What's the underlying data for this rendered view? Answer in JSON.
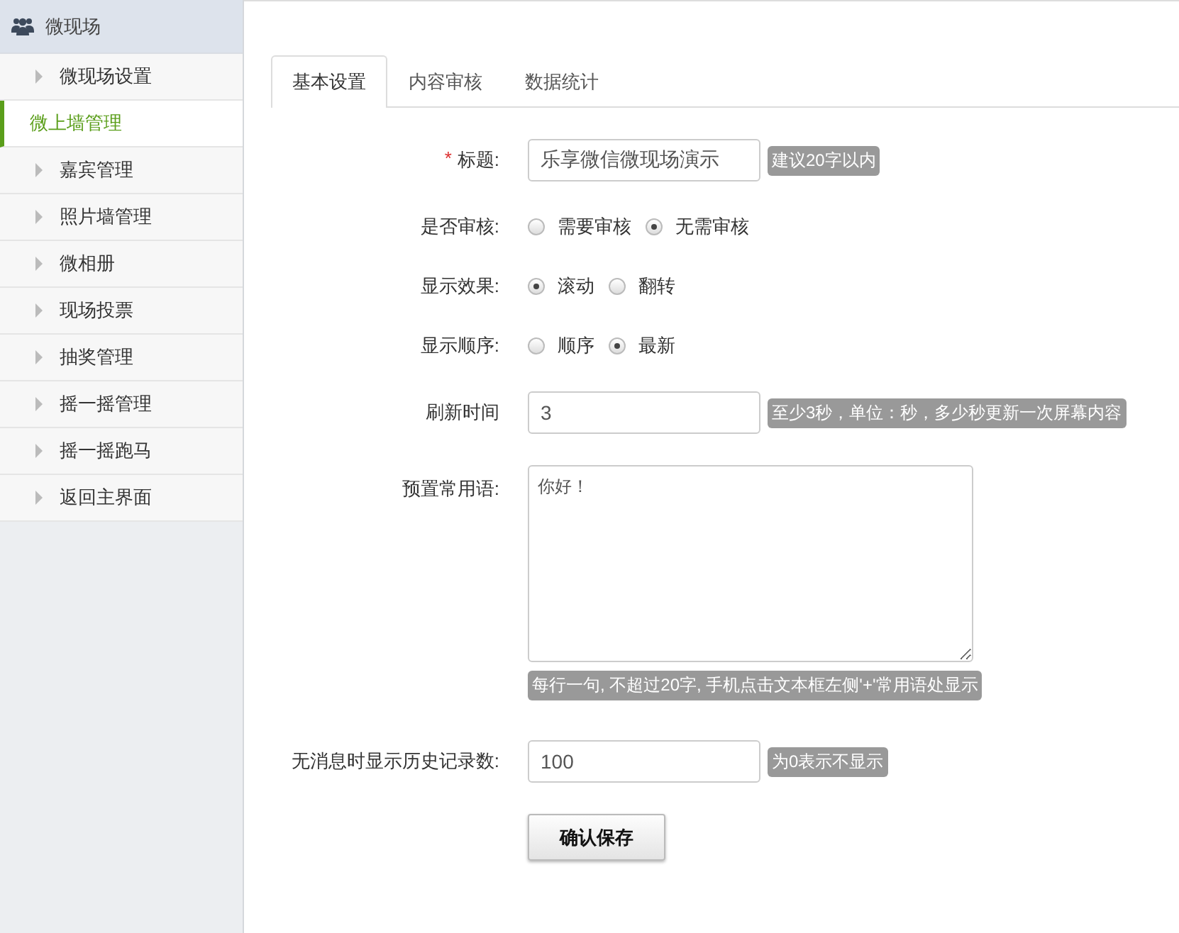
{
  "sidebar": {
    "title": "微现场",
    "items": [
      {
        "label": "微现场设置",
        "selected": false
      },
      {
        "label": "微上墙管理",
        "selected": true
      },
      {
        "label": "嘉宾管理",
        "selected": false
      },
      {
        "label": "照片墙管理",
        "selected": false
      },
      {
        "label": "微相册",
        "selected": false
      },
      {
        "label": "现场投票",
        "selected": false
      },
      {
        "label": "抽奖管理",
        "selected": false
      },
      {
        "label": "摇一摇管理",
        "selected": false
      },
      {
        "label": "摇一摇跑马",
        "selected": false
      },
      {
        "label": "返回主界面",
        "selected": false
      }
    ]
  },
  "tabs": [
    {
      "label": "基本设置",
      "selected": true
    },
    {
      "label": "内容审核",
      "selected": false
    },
    {
      "label": "数据统计",
      "selected": false
    }
  ],
  "form": {
    "fields": [
      {
        "kind": "text",
        "required_mark": "*",
        "label": "标题:",
        "value": "乐享微信微现场演示",
        "hint": "建议20字以内"
      },
      {
        "kind": "radio",
        "label": "是否审核:",
        "options": [
          {
            "label": "需要审核",
            "selected": false
          },
          {
            "label": "无需审核",
            "selected": true
          }
        ]
      },
      {
        "kind": "radio",
        "label": "显示效果:",
        "options": [
          {
            "label": "滚动",
            "selected": true
          },
          {
            "label": "翻转",
            "selected": false
          }
        ]
      },
      {
        "kind": "radio",
        "label": "显示顺序:",
        "options": [
          {
            "label": "顺序",
            "selected": false
          },
          {
            "label": "最新",
            "selected": true
          }
        ]
      },
      {
        "kind": "text",
        "label": "刷新时间",
        "value": "3",
        "hint": "至少3秒，单位：秒，多少秒更新一次屏幕内容"
      },
      {
        "kind": "textarea",
        "label": "预置常用语:",
        "value": "你好！",
        "hint": "每行一句, 不超过20字, 手机点击文本框左侧'+'常用语处显示"
      },
      {
        "kind": "text",
        "label": "无消息时显示历史记录数:",
        "value": "100",
        "hint": "为0表示不显示"
      }
    ],
    "submit": "确认保存"
  }
}
